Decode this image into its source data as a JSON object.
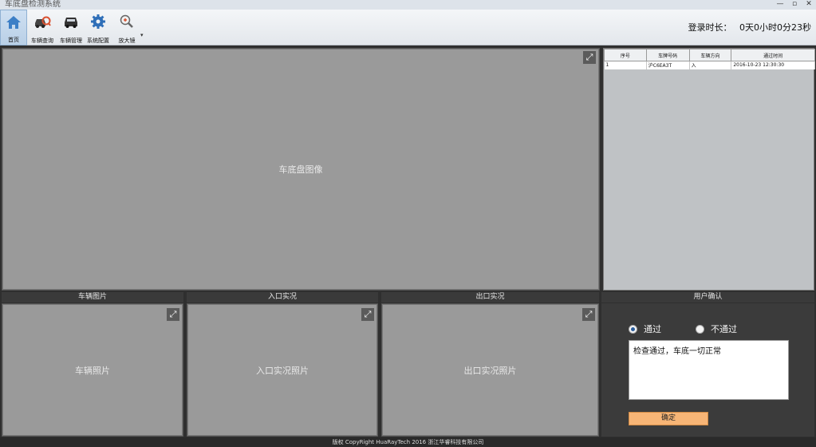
{
  "window": {
    "title": "车底盘检测系统",
    "controls": [
      "—",
      "▫",
      "✕"
    ]
  },
  "toolbar": {
    "items": [
      {
        "label": "首页",
        "icon": "home-icon",
        "active": true
      },
      {
        "label": "车辆查询",
        "icon": "car-search-icon",
        "active": false
      },
      {
        "label": "车辆管理",
        "icon": "car-icon",
        "active": false
      },
      {
        "label": "系统配置",
        "icon": "gear-icon",
        "active": false
      },
      {
        "label": "放大镜",
        "icon": "magnifier-icon",
        "active": false
      }
    ],
    "login_label": "登录时长：",
    "login_value": "0天0小时0分23秒"
  },
  "main_image": {
    "label": "车底盘图像"
  },
  "records": {
    "columns": [
      "序号",
      "车牌号码",
      "车辆方向",
      "通过时间"
    ],
    "rows": [
      [
        "1",
        "沪C6EA3T",
        "入",
        "2016-10-23 12:30:30"
      ]
    ]
  },
  "panels": {
    "vehicle": {
      "title": "车辆图片",
      "image_label": "车辆照片"
    },
    "entry": {
      "title": "入口实况",
      "image_label": "入口实况照片"
    },
    "exit": {
      "title": "出口实况",
      "image_label": "出口实况照片"
    },
    "confirm": {
      "title": "用户确认"
    }
  },
  "confirm": {
    "pass_label": "通过",
    "fail_label": "不通过",
    "selected": "pass",
    "remark": "检查通过，车底一切正常",
    "button_label": "确定"
  },
  "footer": {
    "text": "版权 CopyRight HuaRayTech 2016 浙江华睿科技有限公司"
  },
  "colors": {
    "accent": "#2a5d9c",
    "button": "#f7b576",
    "background": "#2f2f2f"
  }
}
